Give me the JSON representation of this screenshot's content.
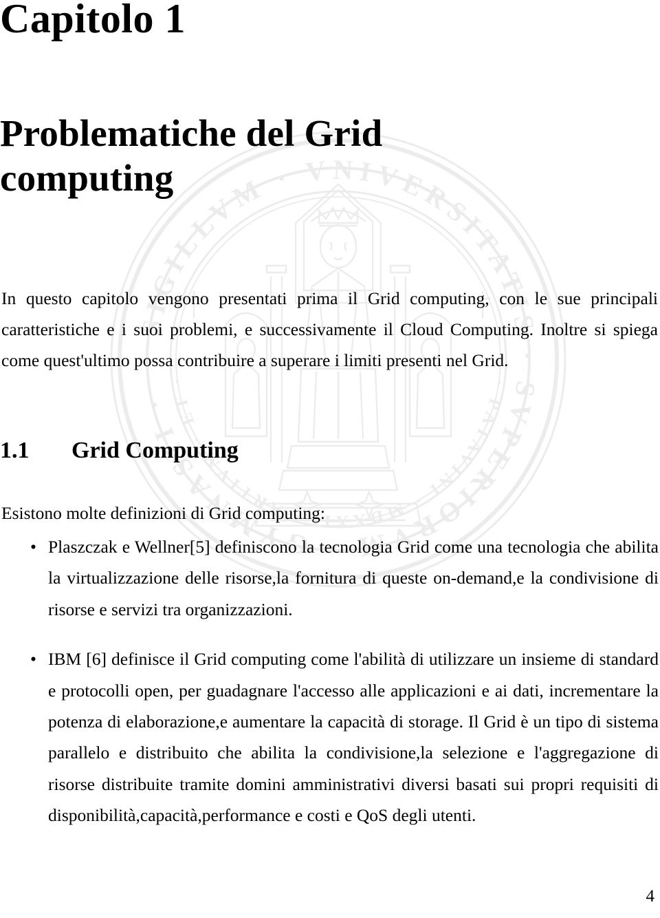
{
  "document": {
    "chapter_number": "Capitolo 1",
    "chapter_title": "Problematiche del Grid computing",
    "intro_paragraph": "In questo capitolo vengono presentati prima il Grid computing, con le sue principali caratteristiche e i suoi problemi, e successivamente il Cloud Computing. Inoltre si spiega come quest'ultimo possa contribuire a superare i limiti presenti nel Grid.",
    "section": {
      "number": "1.1",
      "title": "Grid Computing",
      "lead_in": "Esistono molte definizioni di Grid computing:",
      "bullets": [
        {
          "marker": "•",
          "text": "Plaszczak e Wellner[5] definiscono la tecnologia Grid come una tecnologia che abilita la virtualizzazione delle risorse,la fornitura di queste on-demand,e la condivisione di risorse e servizi tra organizzazioni."
        },
        {
          "marker": "•",
          "text": "IBM [6] definisce il Grid computing come l'abilità di utilizzare un insieme di standard e protocolli open, per guadagnare l'accesso alle applicazioni e ai dati, incrementare la potenza di elaborazione,e aumentare la capacità di storage. Il Grid è un tipo di sistema parallelo e distribuito che abilita la condivisione,la selezione e l'aggregazione di risorse distribuite tramite domini amministrativi diversi basati sui propri requisiti di disponibilità,capacità,performance e costi e QoS degli utenti."
        }
      ]
    },
    "page_number": "4",
    "watermark": {
      "name": "university-seal-watermark",
      "outer_text": "SIGILLVM · VNIVERSITATIS · PATAVINI ·",
      "inner_text": "GYMNASII · PATAVINI · MDXXII ·",
      "color": "#3b3540"
    }
  },
  "colors": {
    "text": "#000000",
    "background": "#ffffff",
    "watermark": "#3b3540"
  }
}
